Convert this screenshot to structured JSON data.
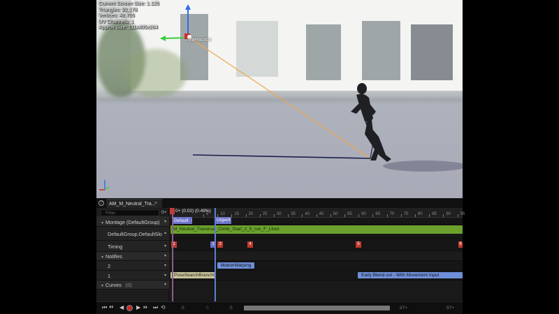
{
  "viewport": {
    "stats": [
      "Current Screen Size: 1.125",
      "Triangles: 92,178",
      "Vertices: 48,705",
      "UV Channels: 1",
      "Approx Size: 111x405x264"
    ],
    "gizmo_label": "Interaction"
  },
  "editor": {
    "tab_label": "AM_M_Neutral_Tra...",
    "tab_close": "×",
    "help_icon": "?",
    "filter_placeholder": "Filter",
    "filter_add": "0+",
    "dropdown_arrow": "▾",
    "collapse_arrow": "▾",
    "rows": {
      "montage": "Montage (DefaultGroup)",
      "slot": "DefaultGroup.DefaultSlo",
      "timing": "Timing",
      "notifies": "Notifies",
      "track2": "2",
      "track1": "1",
      "curves": "Curves",
      "curves_count": "(0)"
    },
    "time_readout": "0+ (0.02) (0.49%)",
    "ruler_ticks": [
      "5",
      "10",
      "15",
      "20",
      "25",
      "30",
      "35",
      "40",
      "45",
      "50",
      "55",
      "60",
      "65",
      "70",
      "75",
      "80",
      "85",
      "90",
      "95"
    ],
    "sections": {
      "default": "Default",
      "default_arrow": "➔",
      "urgent": "Urgent"
    },
    "segment_label": "M_Neutral_Traversal_Climb_Start_2_5_run_F_Lfoot",
    "timing_markers": [
      "1",
      "2",
      "3",
      "4",
      "5",
      "6"
    ],
    "notifies": {
      "motion_warping": "MotionWarping",
      "pose_search": "PoseSearchBranchI",
      "early_blend": "Early Blend out - With Movement Input"
    },
    "transport": {
      "to_start": "⏮",
      "step_back": "⏴⏴",
      "play_reverse": "◀",
      "record": "",
      "play": "▶",
      "step_forward": "⏵⏵",
      "to_end": "⏭",
      "loop": "⟲",
      "start_val": "0",
      "mid_val": "0",
      "cur_val": "0",
      "end_val": "97+",
      "end_val2": "97+"
    }
  },
  "colors": {
    "accent_green": "#6ba02c",
    "playhead_red": "#c23b3b",
    "marker_red": "#c0392b",
    "marker_blue": "#6c6fc6",
    "section_blue": "#6d74c9",
    "notify_blue": "#6f8fd8",
    "notify_yellow": "#c9c39a"
  }
}
